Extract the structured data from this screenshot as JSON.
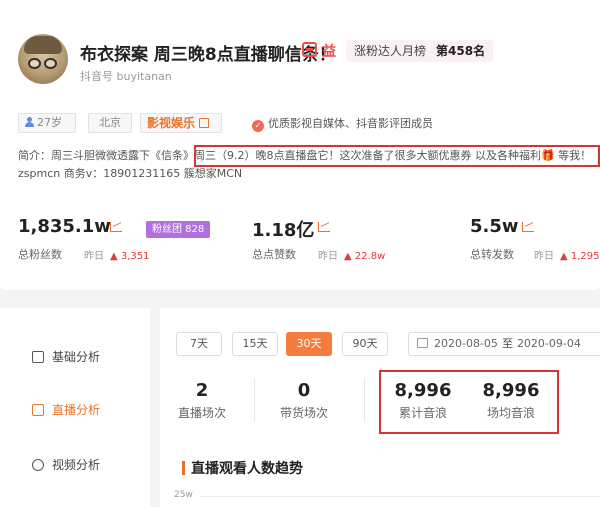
{
  "profile": {
    "title": "布衣探案 周三晚8点直播聊信条！",
    "rank_icon": "益",
    "rank_label": "涨粉达人月榜",
    "rank_value": "第458名",
    "douyin_id": "抖音号 buyitanan",
    "tags": {
      "age": "27岁",
      "city": "北京",
      "category": "影视娱乐"
    },
    "verification": "优质影视自媒体、抖音影评团成员",
    "bio_line1": "简介：周三斗胆微微透露下《信条》周三（9.2）晚8点直播盘它！这次准备了很多大额优惠券 以及各种福利🎁 等我！",
    "bio_line2": "zspmcn 商务v：18901231165 簇想家MCN"
  },
  "stats": [
    {
      "value": "1,835.1w",
      "label": "总粉丝数",
      "yesterday_label": "昨日",
      "yesterday_value": "3,351"
    },
    {
      "value": "1.18亿",
      "label": "总点赞数",
      "yesterday_label": "昨日",
      "yesterday_value": "22.8w"
    },
    {
      "value": "5.5w",
      "label": "总转发数",
      "yesterday_label": "昨日",
      "yesterday_value": "1,295"
    }
  ],
  "fans_club": "粉丝团 828",
  "sidebar": {
    "items": [
      {
        "label": "基础分析",
        "icon": "chart-icon"
      },
      {
        "label": "直播分析",
        "icon": "live-icon"
      },
      {
        "label": "视频分析",
        "icon": "play-icon"
      }
    ]
  },
  "date_filter": {
    "ranges": [
      "7天",
      "15天",
      "30天",
      "90天"
    ],
    "active": "30天",
    "start": "2020-08-05",
    "separator": "至",
    "end": "2020-09-04"
  },
  "metrics": [
    {
      "value": "2",
      "label": "直播场次"
    },
    {
      "value": "0",
      "label": "带货场次"
    },
    {
      "value": "8,996",
      "label": "累计音浪"
    },
    {
      "value": "8,996",
      "label": "场均音浪"
    }
  ],
  "trend": {
    "title": "直播观看人数趋势",
    "y_tick": "25w"
  },
  "colors": {
    "accent": "#e8742a",
    "highlight_box": "#d93434",
    "fans_club": "#b070e0",
    "up": "#e4393c"
  }
}
